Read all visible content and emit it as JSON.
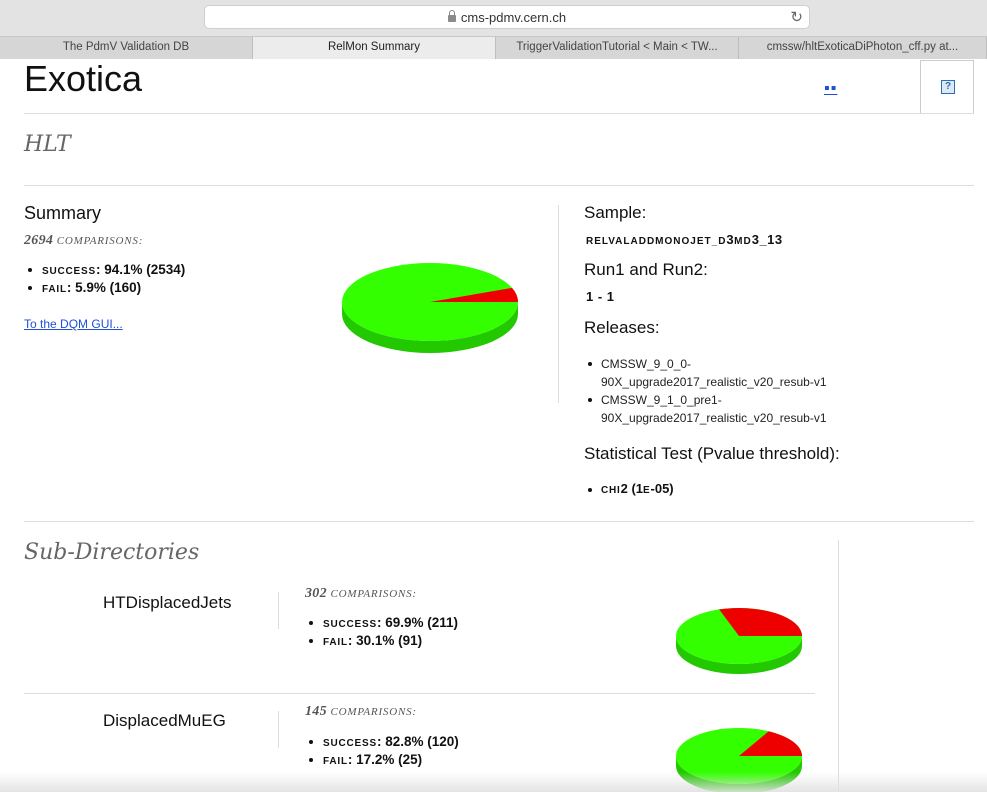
{
  "browser": {
    "url": "cms-pdmv.cern.ch",
    "tabs": [
      {
        "label": "The PdmV Validation DB",
        "width": 253
      },
      {
        "label": "RelMon Summary",
        "width": 243,
        "active": true
      },
      {
        "label": "TriggerValidationTutorial < Main < TW...",
        "width": 243
      },
      {
        "label": "cmssw/hltExoticaDiPhoton_cff.py at...",
        "width": 248
      }
    ]
  },
  "page": {
    "title": "Exotica",
    "logo_text": "▪▪",
    "help_label": "?"
  },
  "hlt": {
    "heading": "HLT",
    "summary_title": "Summary",
    "comparisons_count": "2694",
    "comparisons_label": "comparisons:",
    "success_label": "success",
    "success_value": ": 94.1% (2534)",
    "fail_label": "fail",
    "fail_value": ": 5.9% (160)",
    "success_fraction": 0.941,
    "dqm_link": "To the DQM GUI...",
    "sample_heading": "Sample:",
    "sample_prefix": "relvaladdmonojet_d",
    "sample_mid": "3",
    "sample_md": "md",
    "sample_suffix": "3_13",
    "run_heading": "Run1 and Run2:",
    "run_value": "1 - 1",
    "releases_heading": "Releases:",
    "release_1": "CMSSW_9_0_0-90X_upgrade2017_realistic_v20_resub-v1",
    "release_2": "CMSSW_9_1_0_pre1-90X_upgrade2017_realistic_v20_resub-v1",
    "stat_test_heading": "Statistical Test (Pvalue threshold):",
    "stat_test_name": "chi",
    "stat_test_num": "2",
    "stat_test_open": " (1",
    "stat_test_e": "e",
    "stat_test_exp": "-05)"
  },
  "subdirs": {
    "heading": "Sub-Directories",
    "items": [
      {
        "name": "HTDisplacedJets",
        "comparisons_count": "302",
        "comparisons_label": "comparisons:",
        "success_label": "success",
        "success_value": ": 69.9% (211)",
        "fail_label": "fail",
        "fail_value": ": 30.1% (91)",
        "success_fraction": 0.699
      },
      {
        "name": "DisplacedMuEG",
        "comparisons_count": "145",
        "comparisons_label": "comparisons:",
        "success_label": "success",
        "success_value": ": 82.8% (120)",
        "fail_label": "fail",
        "fail_value": ": 17.2% (25)",
        "success_fraction": 0.828
      }
    ]
  },
  "colors": {
    "success": "#33ff00",
    "success_side": "#22c800",
    "fail": "#ee0000",
    "link": "#1f4fd6"
  }
}
